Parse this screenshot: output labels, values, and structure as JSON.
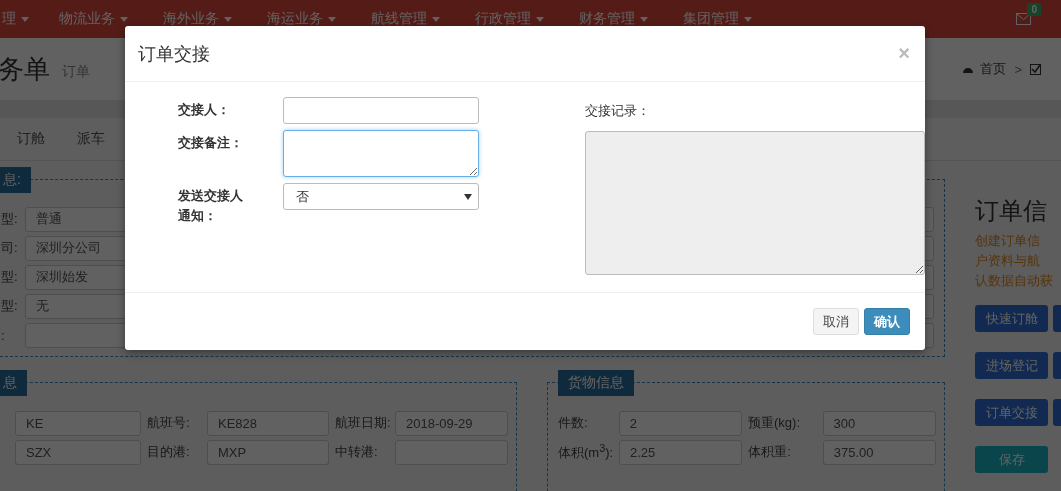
{
  "nav": {
    "items": [
      {
        "label": "理"
      },
      {
        "label": "物流业务"
      },
      {
        "label": "海外业务"
      },
      {
        "label": "海运业务"
      },
      {
        "label": "航线管理"
      },
      {
        "label": "行政管理"
      },
      {
        "label": "财务管理"
      },
      {
        "label": "集团管理"
      }
    ],
    "mail_badge": "0"
  },
  "header": {
    "title": "务单",
    "subtitle": "订单",
    "breadcrumb": "首页",
    "separator": ">"
  },
  "tabs": [
    {
      "label": "订舱"
    },
    {
      "label": "派车"
    }
  ],
  "basic_section": {
    "legend": "息:",
    "rows": [
      {
        "label": "型:",
        "value": "普通"
      },
      {
        "label": "司:",
        "value": "深圳分公司"
      },
      {
        "label": "型:",
        "value": "深圳始发"
      },
      {
        "label": "型:",
        "value": "无"
      },
      {
        "label": ":"
      }
    ]
  },
  "flight_section": {
    "legend": "息",
    "rows": [
      [
        {
          "value": "KE"
        },
        {
          "label": "航班号:",
          "value": "KE828"
        },
        {
          "label": "航班日期:",
          "value": "2018-09-29"
        }
      ],
      [
        {
          "value": "SZX"
        },
        {
          "label": "目的港:",
          "value": "MXP"
        },
        {
          "label": "中转港:"
        }
      ]
    ]
  },
  "cargo_section": {
    "legend": "货物信息",
    "rows": [
      [
        {
          "label": "件数:",
          "value": "2"
        },
        {
          "label": "预重(kg):",
          "value": "300"
        }
      ],
      [
        {
          "label": "体积(m$^{3}$):",
          "value": "2.25"
        },
        {
          "label": "体积重:",
          "value": "375.00"
        }
      ]
    ]
  },
  "side": {
    "title": "订单信",
    "notes": [
      "创建订单信",
      "户资料与航",
      "认数据自动获"
    ],
    "buttons": [
      {
        "label": "快速订舱",
        "kind": "primary"
      },
      {
        "label": "进场登记",
        "kind": "primary"
      },
      {
        "label": "订单交接",
        "kind": "primary"
      },
      {
        "label": "保存",
        "kind": "success"
      }
    ]
  },
  "modal": {
    "title": "订单交接",
    "close": "×",
    "fields": [
      {
        "label": "交接人：",
        "kind": "input"
      },
      {
        "label": "交接备注：",
        "kind": "textarea",
        "focused": true
      },
      {
        "label": "发送交接人通知：",
        "kind": "select",
        "value": "否"
      }
    ],
    "record_label": "交接记录：",
    "buttons": [
      {
        "label": "取消",
        "kind": "default"
      },
      {
        "label": "确认",
        "kind": "primary"
      }
    ]
  }
}
